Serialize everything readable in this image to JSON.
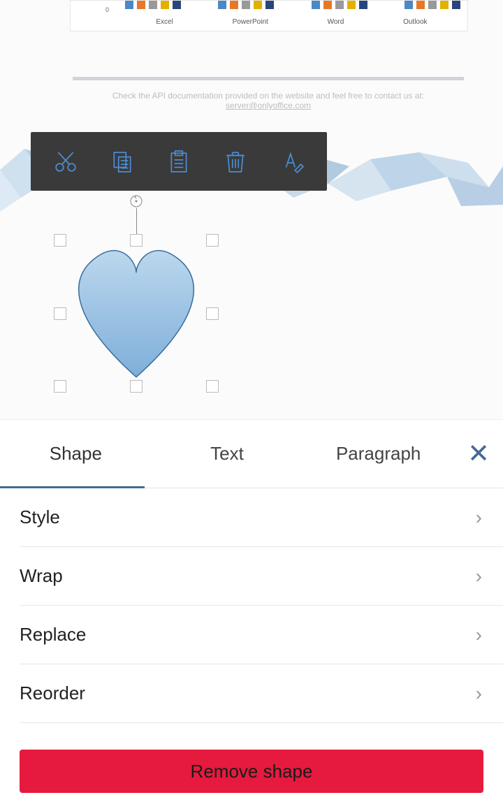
{
  "chart": {
    "zero": "0",
    "labels": [
      "Excel",
      "PowerPoint",
      "Word",
      "Outlook"
    ]
  },
  "api_text": "Check the API documentation provided on the website and feel free to contact us at:",
  "api_link": "server@onlyoffice.com",
  "tabs": {
    "shape": "Shape",
    "text": "Text",
    "paragraph": "Paragraph"
  },
  "options": {
    "style": "Style",
    "wrap": "Wrap",
    "replace": "Replace",
    "reorder": "Reorder"
  },
  "remove": "Remove shape"
}
